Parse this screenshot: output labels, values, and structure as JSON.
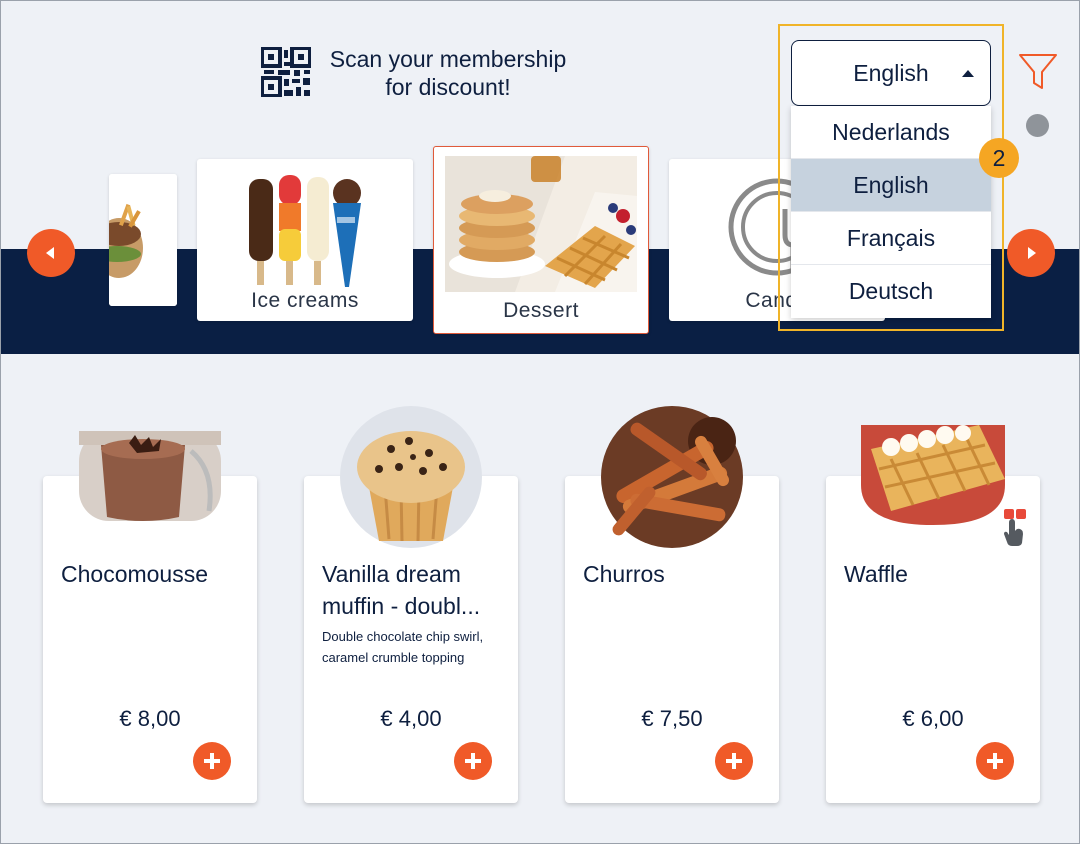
{
  "header": {
    "scan_line1": "Scan your membership",
    "scan_line2": "for discount!",
    "qr_icon": "qr-code-icon"
  },
  "language": {
    "current": "English",
    "options": [
      "Nederlands",
      "English",
      "Français",
      "Deutsch"
    ],
    "selected_index": 1
  },
  "tutorial": {
    "step_badge": "2",
    "highlight_color": "#f0b429",
    "badge_color": "#f5a623"
  },
  "filter": {
    "icon": "filter-icon",
    "color": "#f05a28"
  },
  "categories": [
    {
      "label": "",
      "image": "burger-fries-image"
    },
    {
      "label": "Ice creams",
      "image": "ice-cream-image"
    },
    {
      "label": "Dessert",
      "image": "pancakes-waffles-image",
      "active": true
    },
    {
      "label": "Candy",
      "image": "plate-cutlery-icon"
    }
  ],
  "products": [
    {
      "name": "Chocomousse",
      "description": "",
      "price": "€ 8,00",
      "image": "chocomousse-image"
    },
    {
      "name": "Vanilla dream muffin - doubl...",
      "description": "Double chocolate chip swirl, caramel crumble topping",
      "price": "€ 4,00",
      "image": "muffin-image"
    },
    {
      "name": "Churros",
      "description": "",
      "price": "€ 7,50",
      "image": "churros-image"
    },
    {
      "name": "Waffle",
      "description": "",
      "price": "€ 6,00",
      "image": "waffle-image"
    }
  ],
  "colors": {
    "accent": "#f05a28",
    "navy": "#0a1f44",
    "background": "#eef1f6",
    "selected_option": "#c6d2de"
  }
}
